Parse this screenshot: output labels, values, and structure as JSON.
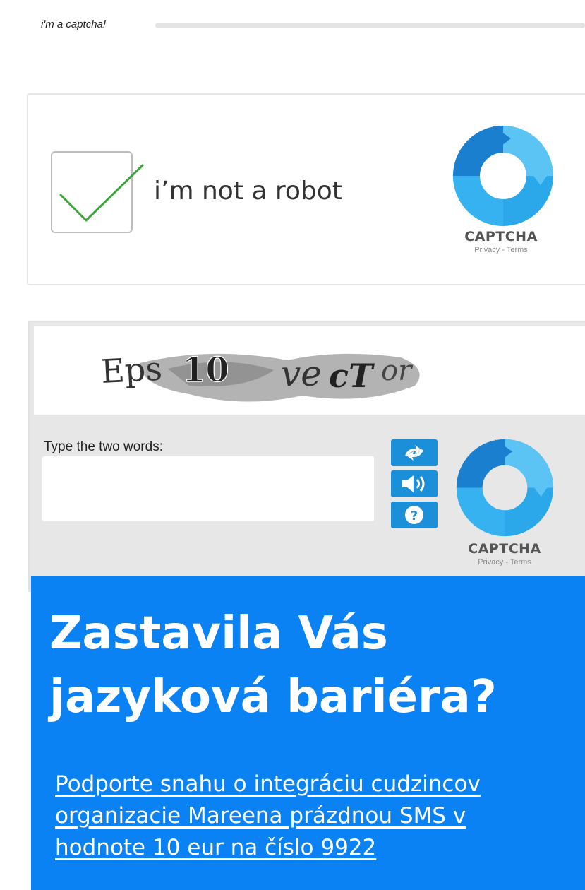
{
  "header": {
    "label": "i'm a captcha!"
  },
  "checkbox_captcha": {
    "label": "i’m not a robot",
    "checked": true,
    "logo": {
      "name": "CAPTCHA",
      "links": "Privacy - Terms"
    }
  },
  "text_captcha": {
    "image_text": "Eps10 vecTor",
    "prompt": "Type the two words:",
    "input_value": "",
    "buttons": {
      "refresh": "refresh-icon",
      "audio": "speaker-icon",
      "help": "?"
    },
    "logo": {
      "name": "CAPTCHA",
      "links": "Privacy - Terms"
    }
  },
  "banner": {
    "headline": [
      "Zastavila Vás",
      "jazyková bariéra?"
    ],
    "link_lines": [
      "Podporte snahu o integráciu cudzincov",
      "organizacie Mareena prázdnou SMS v",
      "hodnote 10 eur na číslo 9922"
    ]
  },
  "colors": {
    "accent_blue": "#0a82f4",
    "button_blue": "#1b8fd8",
    "check_green": "#3aa53a"
  }
}
